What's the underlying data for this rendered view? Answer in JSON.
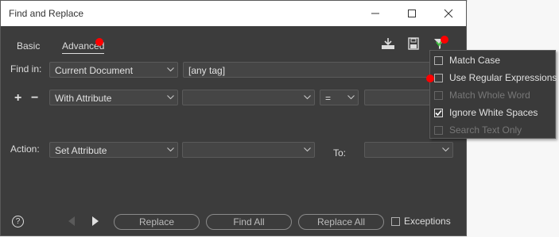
{
  "window": {
    "title": "Find and Replace"
  },
  "tabs": [
    {
      "label": "Basic"
    },
    {
      "label": "Advanced"
    }
  ],
  "find_in": {
    "label": "Find in:",
    "scope": "Current Document",
    "tag": "[any tag]"
  },
  "condition_row": {
    "plus": "+",
    "minus": "−",
    "attribute_type": "With Attribute",
    "operator": "="
  },
  "action": {
    "label": "Action:",
    "value": "Set Attribute",
    "to_label": "To:"
  },
  "buttons": {
    "replace": "Replace",
    "find_all": "Find All",
    "replace_all": "Replace All",
    "help": "?"
  },
  "exceptions": {
    "label": "Exceptions",
    "checked": false
  },
  "options_menu": {
    "items": [
      {
        "label": "Match Case",
        "checked": false,
        "enabled": true
      },
      {
        "label": "Use Regular Expressions",
        "checked": false,
        "enabled": true
      },
      {
        "label": "Match Whole Word",
        "checked": false,
        "enabled": false
      },
      {
        "label": "Ignore White Spaces",
        "checked": true,
        "enabled": true
      },
      {
        "label": "Search Text Only",
        "checked": false,
        "enabled": false
      }
    ]
  },
  "colors": {
    "dialog_bg": "#3c3c3c",
    "marker": "#ff0000",
    "check_accent": "#ffffff"
  }
}
